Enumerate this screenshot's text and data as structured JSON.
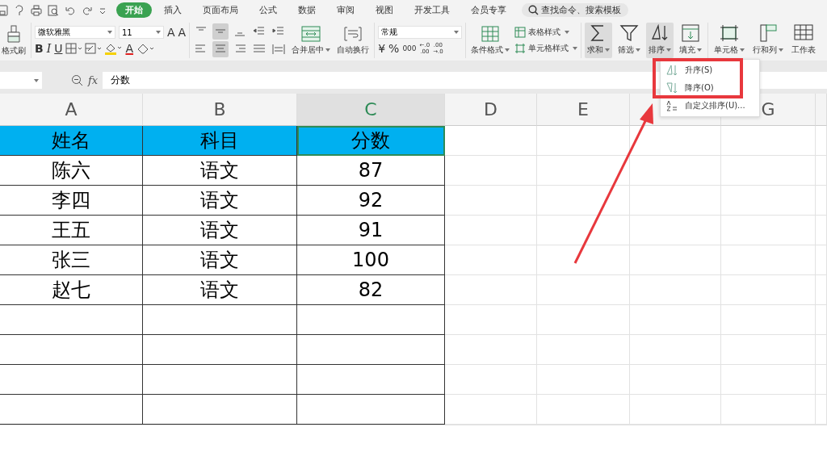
{
  "menu_tabs": [
    {
      "label": "开始",
      "selected": true
    },
    {
      "label": "插入",
      "selected": false
    },
    {
      "label": "页面布局",
      "selected": false
    },
    {
      "label": "公式",
      "selected": false
    },
    {
      "label": "数据",
      "selected": false
    },
    {
      "label": "审阅",
      "selected": false
    },
    {
      "label": "视图",
      "selected": false
    },
    {
      "label": "开发工具",
      "selected": false
    },
    {
      "label": "会员专享",
      "selected": false
    }
  ],
  "search": {
    "placeholder": "查找命令、搜索模板"
  },
  "ribbon": {
    "format_painter": "格式刷",
    "font": {
      "name": "微软雅黑",
      "size": "11",
      "grow": "A",
      "shrink": "A",
      "bold": "B",
      "italic": "I",
      "underline": "U",
      "font_color": "A"
    },
    "alignment": [
      {
        "kind": "top",
        "selected": false
      },
      {
        "kind": "middle",
        "selected": true
      },
      {
        "kind": "bottom",
        "selected": false
      },
      {
        "kind": "outdent",
        "selected": false
      },
      {
        "kind": "indent",
        "selected": false
      },
      {
        "kind": "left",
        "selected": false
      },
      {
        "kind": "center",
        "selected": true
      },
      {
        "kind": "right",
        "selected": false
      },
      {
        "kind": "justify",
        "selected": false
      },
      {
        "kind": "distributed",
        "selected": false
      }
    ],
    "merge": "合并居中",
    "wrap": "自动换行",
    "number_format": "常规",
    "currency": "¥",
    "percent": "%",
    "thousands": "000",
    "decimals": [
      {
        "top": "←.0",
        "bottom": ".00"
      },
      {
        "top": ".00",
        "bottom": "→.0"
      }
    ],
    "conditional_format": "条件格式",
    "table_style": "表格样式",
    "cell_style": "单元格样式",
    "tools": [
      {
        "label": "求和",
        "kind": "sum",
        "pressed": true
      },
      {
        "label": "筛选",
        "kind": "filter",
        "pressed": false
      },
      {
        "label": "排序",
        "kind": "sort",
        "pressed": true
      },
      {
        "label": "填充",
        "kind": "fill",
        "pressed": false
      },
      {
        "label": "单元格",
        "kind": "cell",
        "pressed": false
      },
      {
        "label": "行和列",
        "kind": "rowcol",
        "pressed": false
      },
      {
        "label": "工作表",
        "kind": "sheet",
        "pressed": false,
        "no_caret": true
      }
    ]
  },
  "formula_bar": {
    "fx": "fx",
    "value": "分数"
  },
  "columns": [
    {
      "label": "A",
      "selected": false
    },
    {
      "label": "B",
      "selected": false
    },
    {
      "label": "C",
      "selected": true
    },
    {
      "label": "D",
      "selected": false
    },
    {
      "label": "E",
      "selected": false
    },
    {
      "selected": false
    },
    {
      "label": "G",
      "selected": false
    }
  ],
  "table": {
    "header": [
      {
        "text": "姓名",
        "selected": false
      },
      {
        "text": "科目",
        "selected": false
      },
      {
        "text": "分数",
        "selected": true
      }
    ],
    "rows": [
      [
        "陈六",
        "语文",
        "87"
      ],
      [
        "李四",
        "语文",
        "92"
      ],
      [
        "王五",
        "语文",
        "91"
      ],
      [
        "张三",
        "语文",
        "100"
      ],
      [
        "赵七",
        "语文",
        "82"
      ]
    ]
  },
  "sort_menu": {
    "items": [
      {
        "label": "升序(S)",
        "kind": "asc"
      },
      {
        "label": "降序(O)",
        "kind": "desc"
      },
      {
        "label": "自定义排序(U)...",
        "kind": "custom"
      }
    ]
  }
}
